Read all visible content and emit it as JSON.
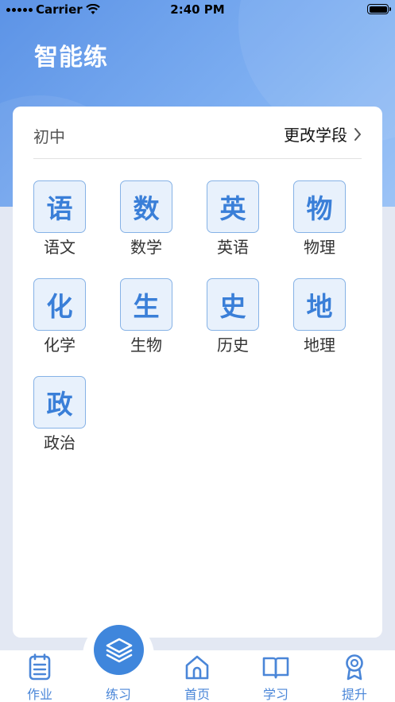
{
  "status_bar": {
    "carrier": "Carrier",
    "time": "2:40 PM"
  },
  "header": {
    "title": "智能练"
  },
  "grade": {
    "label": "初中",
    "change_label": "更改学段"
  },
  "subjects": [
    {
      "char": "语",
      "name": "语文"
    },
    {
      "char": "数",
      "name": "数学"
    },
    {
      "char": "英",
      "name": "英语"
    },
    {
      "char": "物",
      "name": "物理"
    },
    {
      "char": "化",
      "name": "化学"
    },
    {
      "char": "生",
      "name": "生物"
    },
    {
      "char": "史",
      "name": "历史"
    },
    {
      "char": "地",
      "name": "地理"
    },
    {
      "char": "政",
      "name": "政治"
    }
  ],
  "tabbar": {
    "items": [
      {
        "label": "作业",
        "icon": "clipboard-icon"
      },
      {
        "label": "练习",
        "icon": "layers-icon",
        "active": true
      },
      {
        "label": "首页",
        "icon": "home-icon"
      },
      {
        "label": "学习",
        "icon": "book-icon"
      },
      {
        "label": "提升",
        "icon": "award-icon"
      }
    ]
  },
  "colors": {
    "accent": "#3f86dc",
    "tile_bg": "#e8f1fc",
    "tile_border": "#86b2e6",
    "header_gradient_start": "#5c93e6",
    "header_gradient_end": "#9cc3f6",
    "page_bg": "#e3e8f3"
  }
}
